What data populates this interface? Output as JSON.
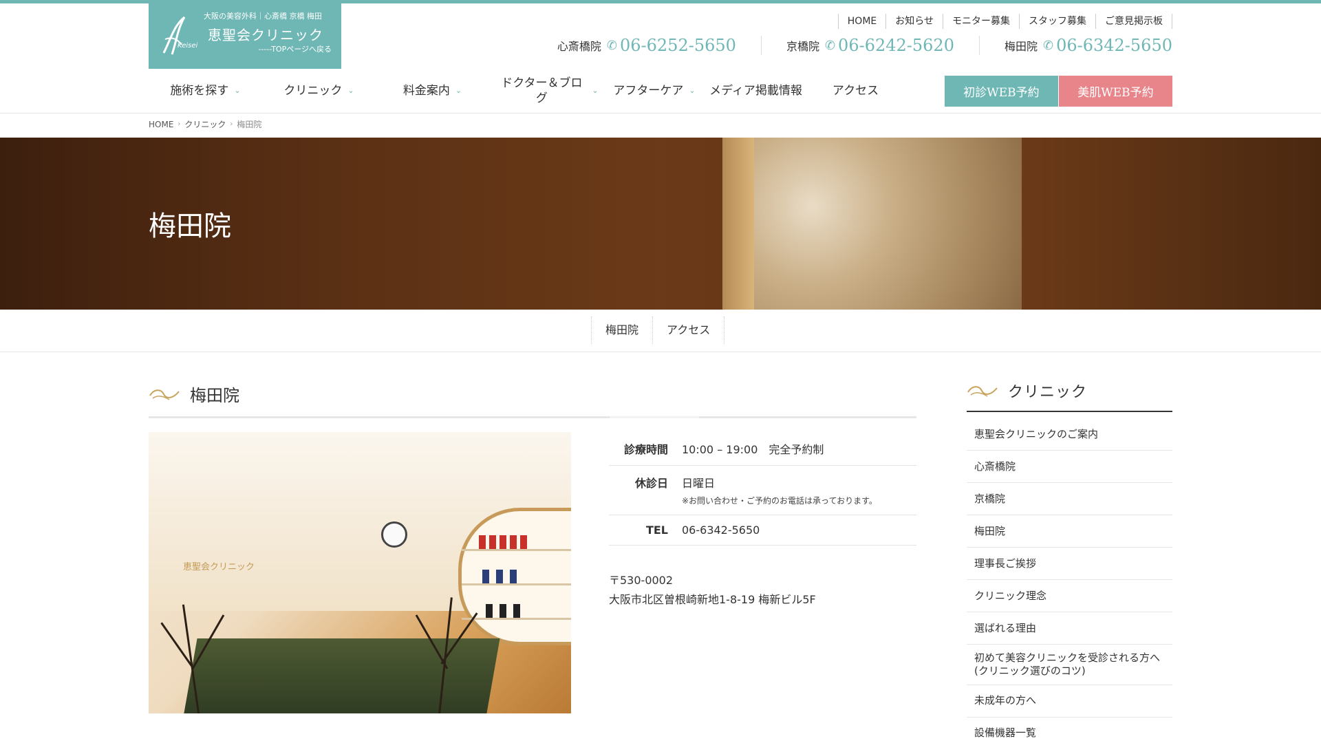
{
  "logo": {
    "subtitle": "大阪の美容外科｜心斎橋 京橋 梅田",
    "name": "恵聖会クリニック",
    "back_link": "-----TOPページへ戻る",
    "mark_text": "Keisei"
  },
  "top_links": [
    "HOME",
    "お知らせ",
    "モニター募集",
    "スタッフ募集",
    "ご意見掲示板"
  ],
  "phones": [
    {
      "branch": "心斎橋院",
      "number": "06-6252-5650"
    },
    {
      "branch": "京橋院",
      "number": "06-6242-5620"
    },
    {
      "branch": "梅田院",
      "number": "06-6342-5650"
    }
  ],
  "nav": {
    "items": [
      "施術を探す",
      "クリニック",
      "料金案内",
      "ドクター＆ブログ",
      "アフターケア",
      "メディア掲載情報",
      "アクセス"
    ],
    "btn_first": "初診WEB予約",
    "btn_skin": "美肌WEB予約"
  },
  "breadcrumb": [
    "HOME",
    "クリニック",
    "梅田院"
  ],
  "hero_title": "梅田院",
  "subtabs": [
    "梅田院",
    "アクセス"
  ],
  "section": {
    "title": "梅田院",
    "photo_logo": "恵聖会クリニック"
  },
  "info": {
    "hours_label": "診療時間",
    "hours_value": "10:00 – 19:00　完全予約制",
    "closed_label": "休診日",
    "closed_value": "日曜日",
    "closed_note": "※お問い合わせ・ご予約のお電話は承っております。",
    "tel_label": "TEL",
    "tel_value": "06-6342-5650"
  },
  "address": {
    "zip": "〒530-0002",
    "line": "大阪市北区曽根崎新地1-8-19 梅新ビル5F"
  },
  "sidebar": {
    "title": "クリニック",
    "items": [
      "恵聖会クリニックのご案内",
      "心斎橋院",
      "京橋院",
      "梅田院",
      "理事長ご挨拶",
      "クリニック理念",
      "選ばれる理由",
      "初めて美容クリニックを受診される方へ(クリニック選びのコツ)",
      "未成年の方へ",
      "設備機器一覧"
    ]
  },
  "colors": {
    "brand_teal": "#6fb7b5",
    "reserve_pink": "#e8858a"
  },
  "icons": [
    "phone-icon",
    "chevron-down-icon",
    "chevron-right-icon",
    "flourish-icon"
  ]
}
